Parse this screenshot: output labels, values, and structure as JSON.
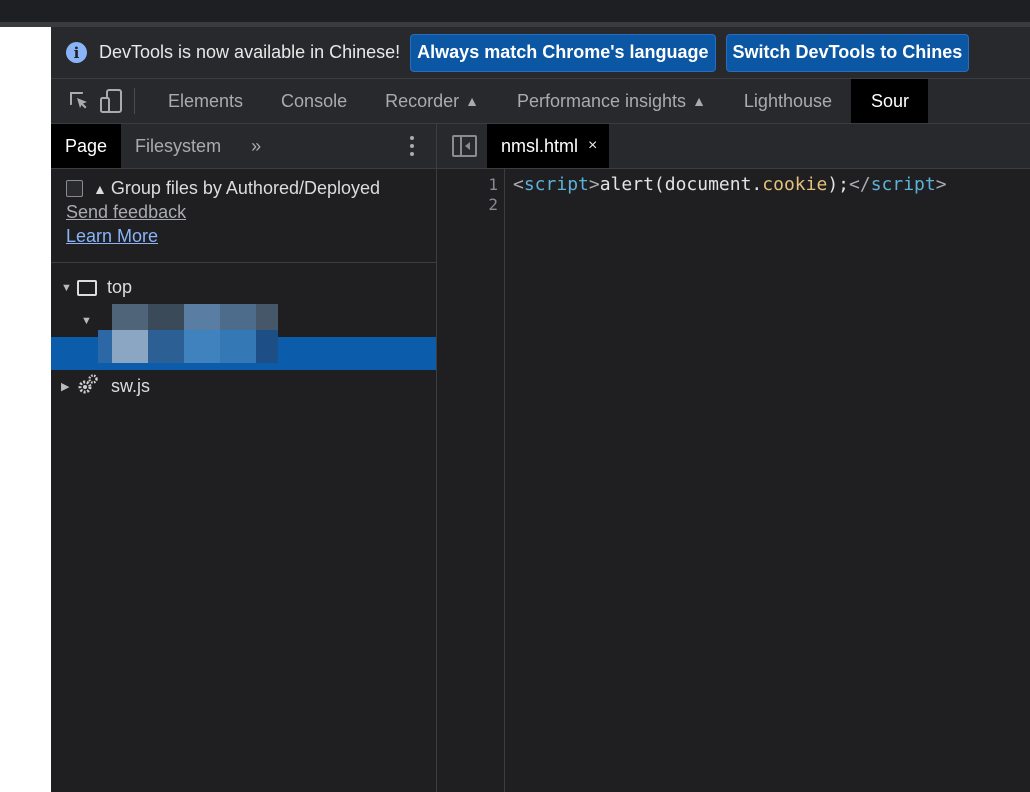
{
  "infobar": {
    "message": "DevTools is now available in Chinese!",
    "match_button": "Always match Chrome's language",
    "switch_button": "Switch DevTools to Chines"
  },
  "tabs": {
    "elements": "Elements",
    "console": "Console",
    "recorder": "Recorder",
    "performance": "Performance insights",
    "lighthouse": "Lighthouse",
    "sources": "Sour"
  },
  "navigator": {
    "tab_page": "Page",
    "tab_filesystem": "Filesystem",
    "more": "»",
    "group_label": "Group files by Authored/Deployed",
    "send_feedback": "Send feedback",
    "learn_more": "Learn More",
    "tree_top": "top",
    "tree_sw": "sw.js"
  },
  "editor": {
    "file_tab": "nmsl.html",
    "close": "×",
    "line_numbers": [
      "1",
      "2"
    ],
    "code": {
      "open_lt": "<",
      "open_tag": "script",
      "open_gt": ">",
      "call": "alert(document.",
      "prop": "cookie",
      "tail": ");",
      "close_lt": "</",
      "close_tag": "script",
      "close_gt": ">"
    }
  },
  "colors": {
    "selected_row": "#0b5cab",
    "button_bg": "#0b57a4",
    "info_icon": "#8ab4f8"
  }
}
